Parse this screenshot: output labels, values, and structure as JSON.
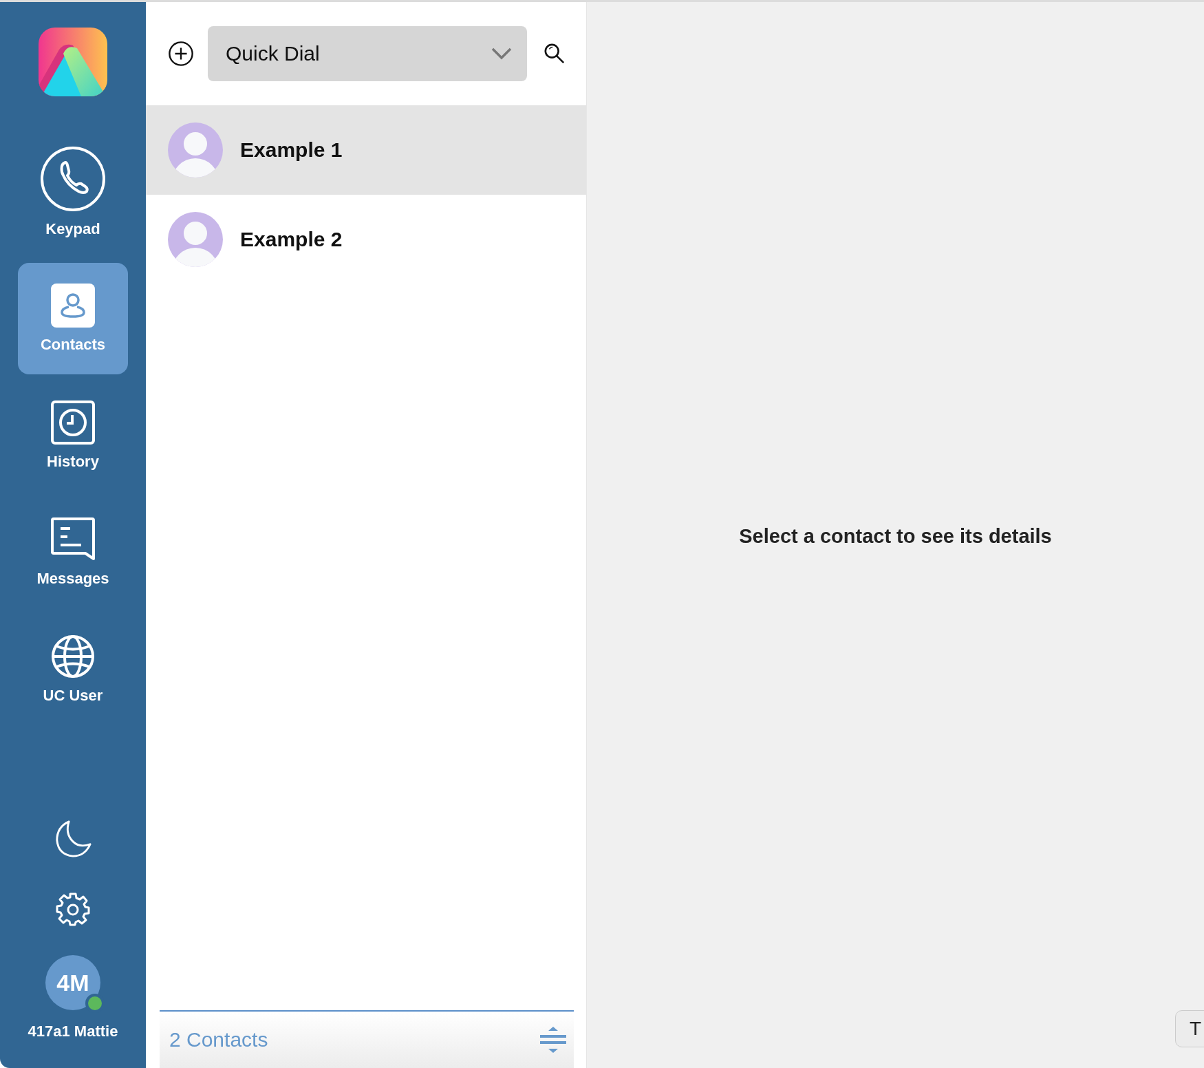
{
  "sidebar": {
    "nav": [
      {
        "kind": "phone",
        "label": "Keypad",
        "selected": false
      },
      {
        "kind": "contacts",
        "label": "Contacts",
        "selected": true
      },
      {
        "kind": "history",
        "label": "History",
        "selected": false
      },
      {
        "kind": "messages",
        "label": "Messages",
        "selected": false
      },
      {
        "kind": "globe",
        "label": "UC User",
        "selected": false
      }
    ],
    "user": {
      "initials": "4M",
      "name": "417a1 Mattie",
      "online": true
    }
  },
  "list_header": {
    "dropdown": "Quick Dial"
  },
  "contacts": [
    {
      "name": "Example 1",
      "selected": true
    },
    {
      "name": "Example 2",
      "selected": false
    }
  ],
  "footer": {
    "count": "2 Contacts"
  },
  "detail": {
    "message": "Select a contact to see its details"
  },
  "corner_button": {
    "label": "T"
  }
}
